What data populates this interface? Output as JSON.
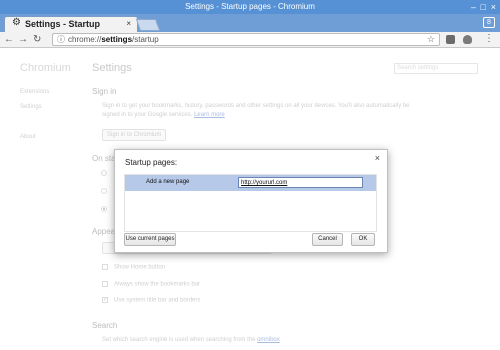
{
  "window": {
    "title": "Settings - Startup pages - Chromium",
    "minimize_glyph": "–",
    "maximize_glyph": "□",
    "close_glyph": "×"
  },
  "tab": {
    "title": "Settings - Startup",
    "icon": "gear-icon",
    "close_glyph": "×"
  },
  "profile_glyph": "8",
  "toolbar": {
    "url_scheme": "chrome://",
    "url_host": "settings",
    "url_path": "/startup"
  },
  "sidebar": {
    "brand": "Chromium",
    "items": [
      {
        "label": "Extensions"
      },
      {
        "label": "Settings"
      },
      {
        "label": "About"
      }
    ]
  },
  "main": {
    "title": "Settings",
    "search_placeholder": "Search settings",
    "sign_in": {
      "heading": "Sign in",
      "description": "Sign in to get your bookmarks, history, passwords and other settings on all your devices. You'll also automatically be signed in to your Google services.",
      "learn_more": "Learn more",
      "button": "Sign in to Chromium"
    },
    "on_startup": {
      "heading": "On start"
    },
    "appearance": {
      "heading": "Appear",
      "checkboxes": [
        {
          "label": "Show Home button",
          "checked": false
        },
        {
          "label": "Always show the bookmarks bar",
          "checked": false
        },
        {
          "label": "Use system title bar and borders",
          "checked": true
        }
      ]
    },
    "search": {
      "heading": "Search",
      "description": "Set which search engine is used when searching from the",
      "link": "omnibox"
    }
  },
  "dialog": {
    "title": "Startup pages:",
    "close_glyph": "×",
    "row_label": "Add a new page",
    "input_value": "http://yoururl.com",
    "use_current": "Use current pages",
    "cancel": "Cancel",
    "ok": "OK"
  },
  "colors": {
    "titlebar": "#5591d4",
    "tabstrip": "#6f9dd5",
    "selected_row": "#b6c9e8"
  }
}
